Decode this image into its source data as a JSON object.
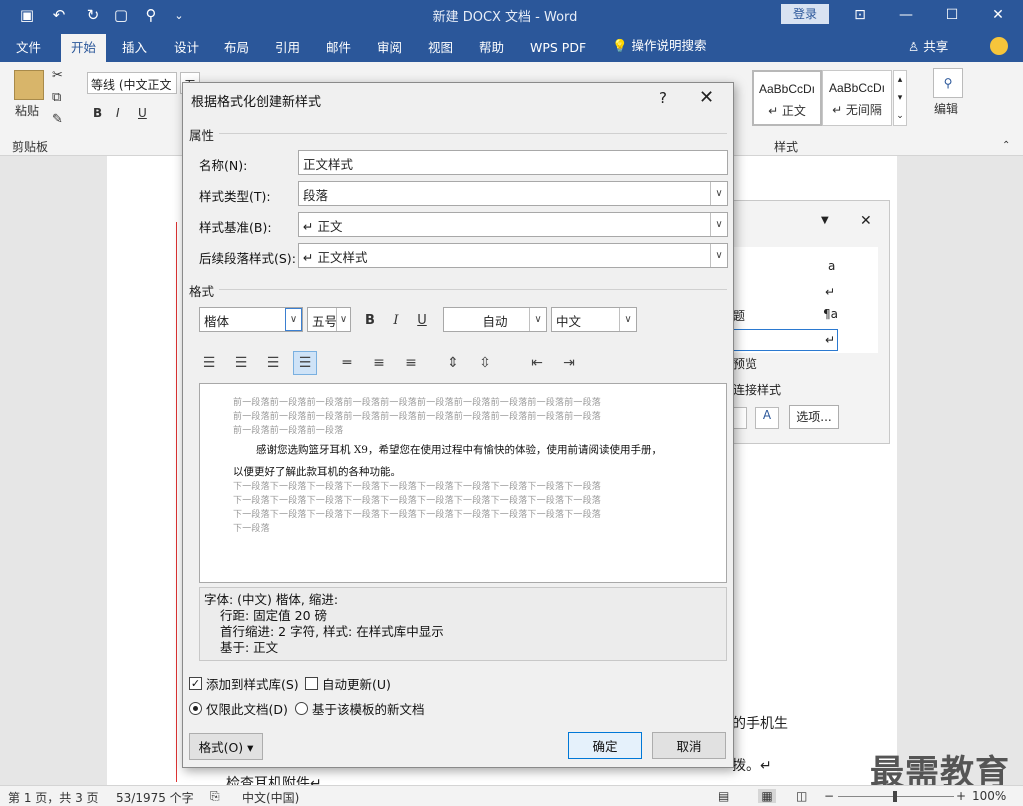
{
  "window": {
    "title": "新建 DOCX 文档  -  Word",
    "login": "登录",
    "quick_access": [
      "save-icon",
      "undo-icon",
      "redo-icon",
      "new-doc-icon",
      "find-icon",
      "more-icon"
    ]
  },
  "tabs": [
    "文件",
    "开始",
    "插入",
    "设计",
    "布局",
    "引用",
    "邮件",
    "审阅",
    "视图",
    "帮助",
    "WPS PDF"
  ],
  "tell_me": "操作说明搜索",
  "share": "共享",
  "ribbon": {
    "paste": "粘贴",
    "clipboard": "剪贴板",
    "font_name": "等线 (中文正文",
    "font_size": "五号",
    "styles_label": "样式",
    "edit_label": "编辑",
    "style_gallery": [
      {
        "sample": "AaBbCcDı",
        "name": "↵ 正文"
      },
      {
        "sample": "AaBbCcDı",
        "name": "↵ 无间隔"
      }
    ]
  },
  "styles_pane": {
    "rows": [
      "a",
      "↵",
      "题",
      "¶a",
      "↵"
    ],
    "preview": "预览",
    "link_styles": "连接样式",
    "options": "选项..."
  },
  "document": {
    "line1": "的手机生",
    "line2": "拨。↵",
    "line3": "检查耳机附件↵"
  },
  "dialog": {
    "title": "根据格式化创建新样式",
    "help": "?",
    "properties_label": "属性",
    "name_label": "名称(N):",
    "name_value": "正文样式",
    "type_label": "样式类型(T):",
    "type_value": "段落",
    "based_label": "样式基准(B):",
    "based_value": "↵ 正文",
    "next_label": "后续段落样式(S):",
    "next_value": "↵ 正文样式",
    "format_label": "格式",
    "font": "楷体",
    "size": "五号",
    "bold": "B",
    "italic": "I",
    "underline": "U",
    "color": "自动",
    "lang": "中文",
    "preview_prev": [
      "前一段落前一段落前一段落前一段落前一段落前一段落前一段落前一段落前一段落前一段落",
      "前一段落前一段落前一段落前一段落前一段落前一段落前一段落前一段落前一段落前一段落",
      "前一段落前一段落前一段落"
    ],
    "preview_main1": "感谢您选购篮牙耳机 X9，希望您在使用过程中有愉快的体验，使用前请阅读使用手册，",
    "preview_main2": "以便更好了解此款耳机的各种功能。",
    "preview_next": [
      "下一段落下一段落下一段落下一段落下一段落下一段落下一段落下一段落下一段落下一段落",
      "下一段落下一段落下一段落下一段落下一段落下一段落下一段落下一段落下一段落下一段落",
      "下一段落下一段落下一段落下一段落下一段落下一段落下一段落下一段落下一段落下一段落",
      "下一段落"
    ],
    "desc": [
      "字体: (中文) 楷体, 缩进:",
      "行距: 固定值 20 磅",
      "首行缩进:  2 字符, 样式: 在样式库中显示",
      "基于: 正文"
    ],
    "add_gallery": "添加到样式库(S)",
    "auto_update": "自动更新(U)",
    "only_doc": "仅限此文档(D)",
    "template_docs": "基于该模板的新文档",
    "format_btn": "格式(O) ▾",
    "ok": "确定",
    "cancel": "取消"
  },
  "status": {
    "page": "第 1 页，共 3 页",
    "words": "53/1975 个字",
    "lang": "中文(中国)",
    "zoom": "100%"
  },
  "watermark": "最需教育"
}
